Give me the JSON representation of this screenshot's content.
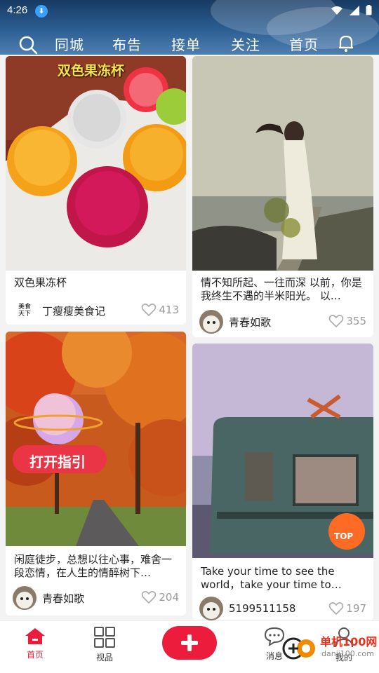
{
  "status_bar": {
    "time": "4:26"
  },
  "nav": {
    "tabs": [
      {
        "label": "同城"
      },
      {
        "label": "布告"
      },
      {
        "label": "接单"
      },
      {
        "label": "关注"
      },
      {
        "label": "首页"
      }
    ],
    "active_tab": "首页"
  },
  "feed": {
    "left": [
      {
        "overlay": "双色果冻杯",
        "title": "双色果冻杯",
        "author": "丁瘦瘦美食记",
        "author_logo": "美食\n天下",
        "likes": "413"
      },
      {
        "overlay": "打开指引",
        "title": "闲庭徒步，总想以往心事，难舍一段恋情，在人生的情醉树下…",
        "author": "青春如歌",
        "likes": "204"
      }
    ],
    "right": [
      {
        "title": "情不知所起、一往而深 以前，你是我终生不遇的半米阳光。 以…",
        "author": "青春如歌",
        "likes": "355"
      },
      {
        "title": "Take your time to see the world，take your time to…",
        "author": "5199511158",
        "likes": "197",
        "badge": "TOP"
      }
    ]
  },
  "bottom_nav": {
    "items": [
      {
        "label": "首页"
      },
      {
        "label": "视品"
      },
      {
        "label": "消息"
      },
      {
        "label": "我的"
      }
    ]
  },
  "watermark": {
    "cn": "单机100网",
    "url": "danji100.com"
  },
  "colors": {
    "accent": "#ec1c3c",
    "header_bg": "#2c5f93",
    "like_gray": "#999999"
  }
}
